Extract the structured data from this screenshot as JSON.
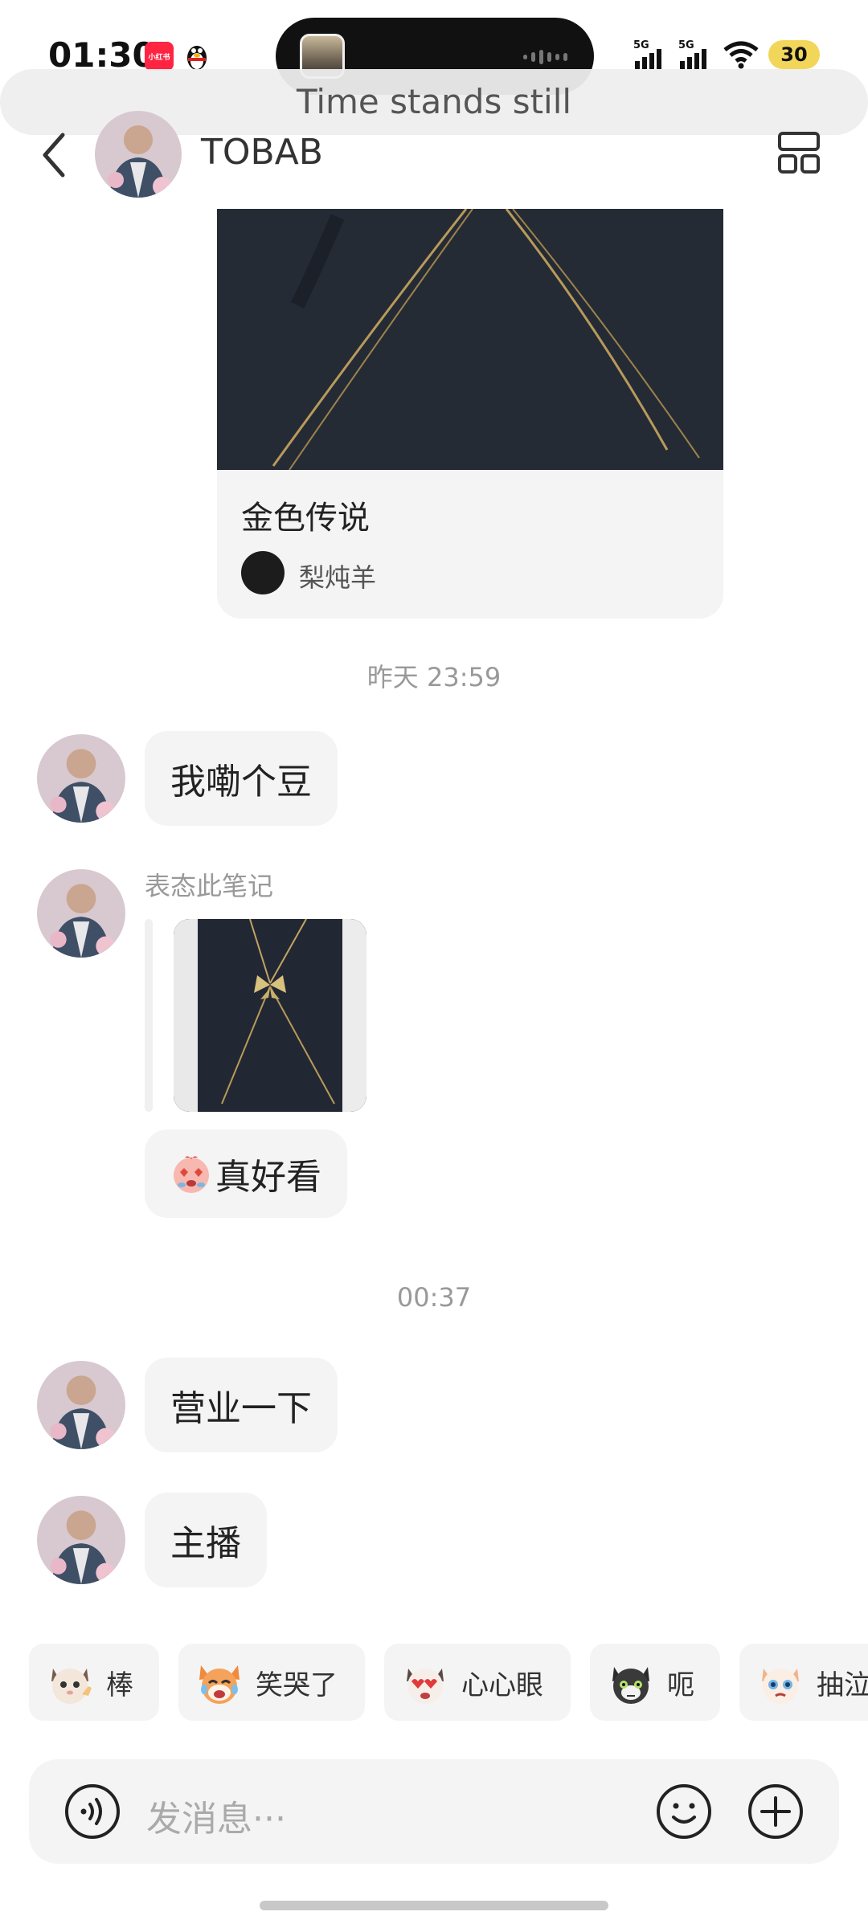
{
  "status_bar": {
    "time": "01:30",
    "app_badge": "小红书",
    "signal_1": "5G",
    "signal_2": "5G",
    "battery": "30"
  },
  "header": {
    "now_playing": "Time stands still",
    "contact_name": "TOBAB"
  },
  "note_card": {
    "title": "金色传说",
    "author": "梨炖羊"
  },
  "messages": {
    "time_1": "昨天 23:59",
    "msg_1": "我嘞个豆",
    "reaction_label": "表态此笔记",
    "msg_2": "真好看",
    "time_2": "00:37",
    "msg_3": "营业一下",
    "msg_4": "主播"
  },
  "stickers": [
    {
      "label": "棒",
      "icon": "cat-thumbs-icon"
    },
    {
      "label": "笑哭了",
      "icon": "fox-laugh-cry-icon"
    },
    {
      "label": "心心眼",
      "icon": "cat-heart-eyes-icon"
    },
    {
      "label": "呃",
      "icon": "black-cat-icon"
    },
    {
      "label": "抽泣",
      "icon": "cat-sob-icon"
    }
  ],
  "input": {
    "placeholder": "发消息···"
  }
}
